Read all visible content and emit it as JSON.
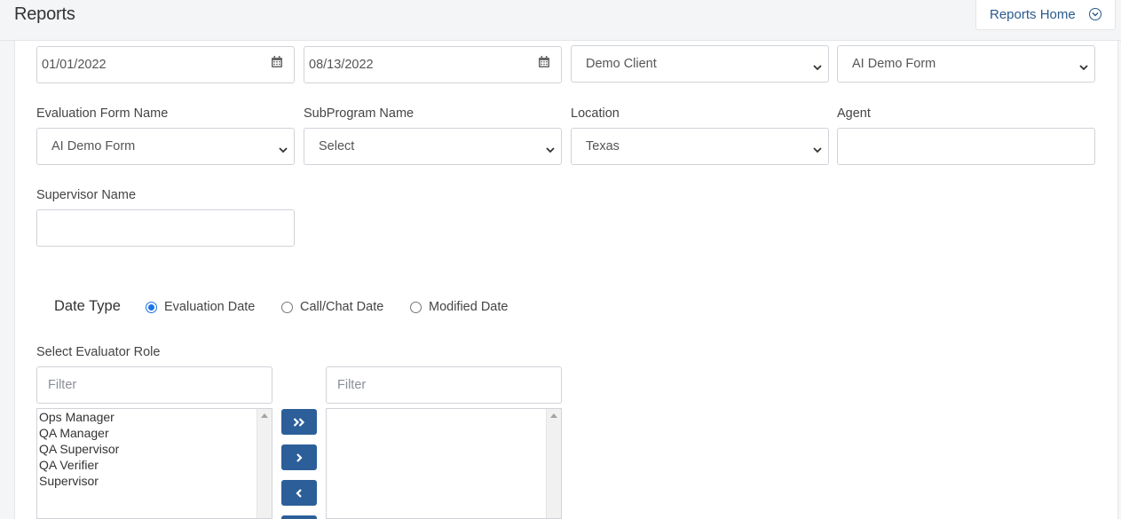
{
  "header": {
    "title": "Reports",
    "home_button": "Reports Home"
  },
  "filters": {
    "start_date": "01/01/2022",
    "end_date": "08/13/2022",
    "client_select": "Demo Client",
    "form_select": "AI Demo Form",
    "evaluation_form_label": "Evaluation Form Name",
    "evaluation_form_value": "AI Demo Form",
    "subprogram_label": "SubProgram Name",
    "subprogram_value": "Select",
    "location_label": "Location",
    "location_value": "Texas",
    "agent_label": "Agent",
    "agent_value": "",
    "supervisor_label": "Supervisor Name",
    "supervisor_value": ""
  },
  "date_type": {
    "label": "Date Type",
    "options": [
      "Evaluation Date",
      "Call/Chat Date",
      "Modified Date"
    ],
    "selected": "Evaluation Date"
  },
  "evaluator_role": {
    "label": "Select Evaluator Role",
    "filter_placeholder": "Filter",
    "available": [
      "Ops Manager",
      "QA Manager",
      "QA Supervisor",
      "QA Verifier",
      "Supervisor"
    ],
    "selected": []
  },
  "colors": {
    "accent": "#2c5f99",
    "link": "#2a5a8c",
    "radio": "#1a73e8"
  },
  "icons": {
    "date": "calendar-icon",
    "select": "chevron-down-icon",
    "move_all_right": "double-chevron-right-icon",
    "move_right": "chevron-right-icon",
    "move_left": "chevron-left-icon"
  }
}
